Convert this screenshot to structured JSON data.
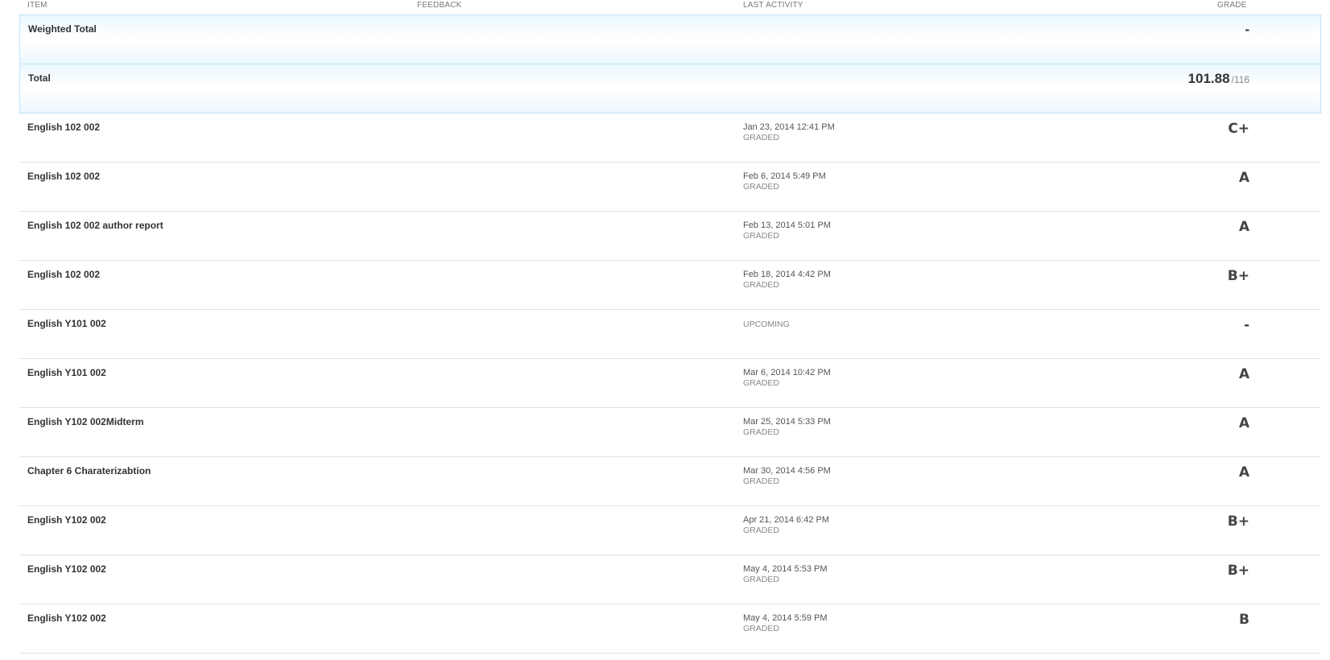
{
  "headers": {
    "item": "ITEM",
    "feedback": "FEEDBACK",
    "last_activity": "LAST ACTIVITY",
    "grade": "GRADE"
  },
  "weighted_total": {
    "label": "Weighted Total",
    "grade": "-"
  },
  "total": {
    "label": "Total",
    "score": "101.88",
    "possible": "/116"
  },
  "items": [
    {
      "name": "English 102 002",
      "date": "Jan 23, 2014 12:41 PM",
      "status": "GRADED",
      "grade": "C+"
    },
    {
      "name": "English 102 002",
      "date": "Feb 6, 2014 5:49 PM",
      "status": "GRADED",
      "grade": "A"
    },
    {
      "name": "English 102 002 author report",
      "date": "Feb 13, 2014 5:01 PM",
      "status": "GRADED",
      "grade": "A"
    },
    {
      "name": "English 102 002",
      "date": "Feb 18, 2014 4:42 PM",
      "status": "GRADED",
      "grade": "B+"
    },
    {
      "name": "English Y101 002",
      "date": "",
      "status": "UPCOMING",
      "grade": "-"
    },
    {
      "name": "English Y101 002",
      "date": "Mar 6, 2014 10:42 PM",
      "status": "GRADED",
      "grade": "A"
    },
    {
      "name": "English Y102 002Midterm",
      "date": "Mar 25, 2014 5:33 PM",
      "status": "GRADED",
      "grade": "A"
    },
    {
      "name": "Chapter 6 Charaterizabtion",
      "date": "Mar 30, 2014 4:56 PM",
      "status": "GRADED",
      "grade": "A"
    },
    {
      "name": "English Y102 002",
      "date": "Apr 21, 2014 6:42 PM",
      "status": "GRADED",
      "grade": "B+"
    },
    {
      "name": "English Y102 002",
      "date": "May 4, 2014 5:53 PM",
      "status": "GRADED",
      "grade": "B+"
    },
    {
      "name": "English Y102 002",
      "date": "May 4, 2014 5:59 PM",
      "status": "GRADED",
      "grade": "B"
    }
  ]
}
